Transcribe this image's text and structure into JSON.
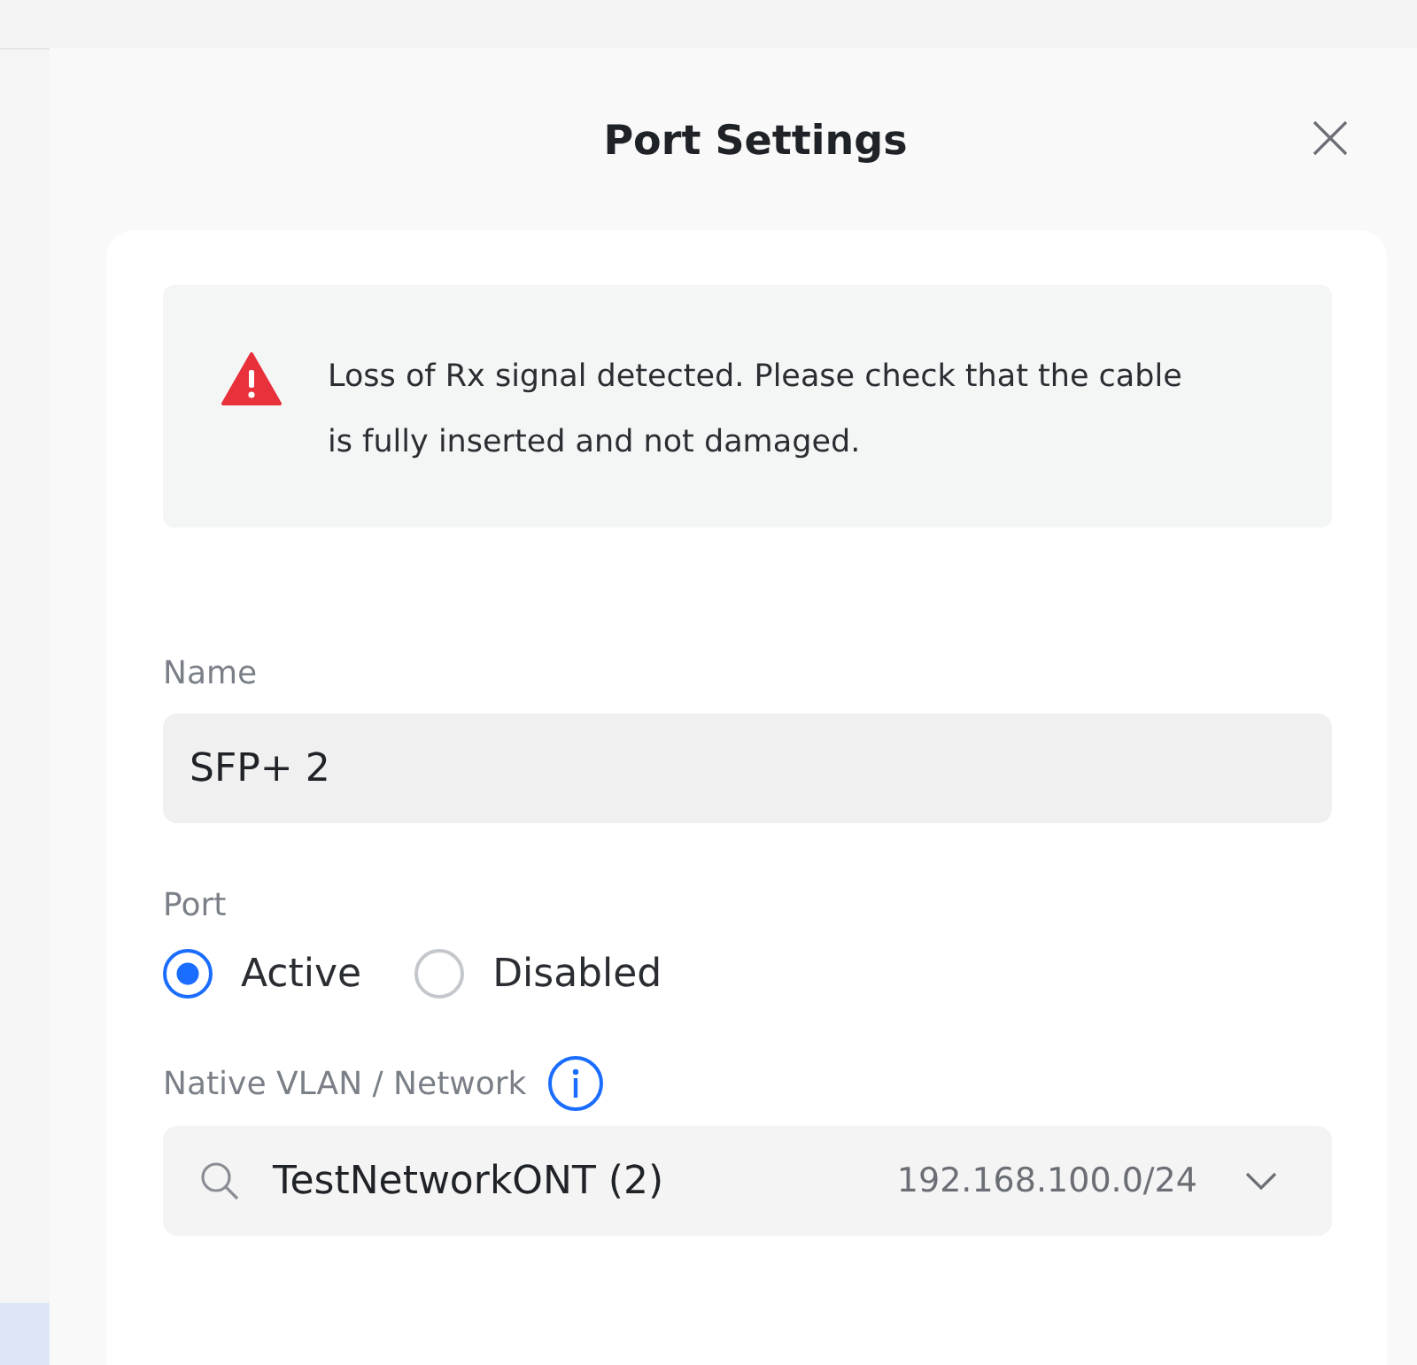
{
  "panel": {
    "title": "Port Settings"
  },
  "alert": {
    "message": "Loss of Rx signal detected. Please check that the cable is fully inserted and not damaged."
  },
  "name_field": {
    "label": "Name",
    "value": "SFP+ 2"
  },
  "port": {
    "label": "Port",
    "options": [
      {
        "label": "Active",
        "selected": true
      },
      {
        "label": "Disabled",
        "selected": false
      }
    ]
  },
  "network": {
    "label": "Native VLAN / Network",
    "value": "TestNetworkONT (2)",
    "subnet": "192.168.100.0/24"
  }
}
